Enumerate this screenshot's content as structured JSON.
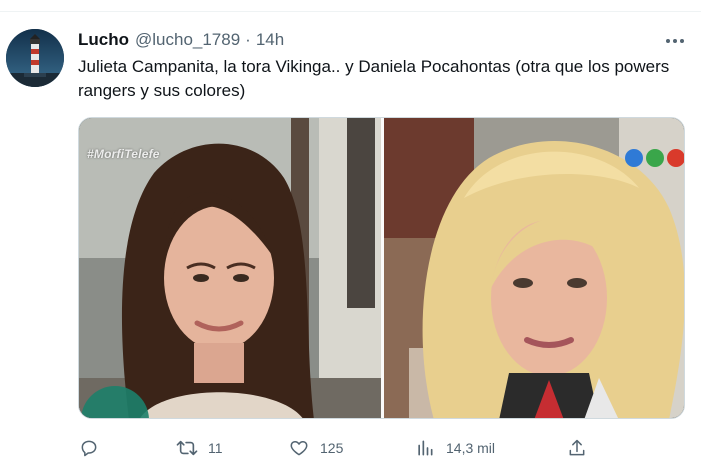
{
  "tweet": {
    "author_name": "Lucho",
    "author_handle": "@lucho_1789",
    "separator": "·",
    "timestamp": "14h",
    "text": "Julieta Campanita, la tora Vikinga.. y Daniela Pocahontas (otra que los powers rangers y sus colores)",
    "media_tag": "#MorfiTelefe",
    "stats": {
      "retweets": "11",
      "likes": "125",
      "views": "14,3 mil"
    }
  },
  "icons": {
    "more": "more-horizontal-icon",
    "reply": "reply-icon",
    "retweet": "retweet-icon",
    "like": "heart-icon",
    "views": "analytics-icon",
    "share": "share-icon"
  },
  "colors": {
    "text_primary": "#0f1419",
    "text_secondary": "#536471",
    "border": "#cfd9de"
  }
}
